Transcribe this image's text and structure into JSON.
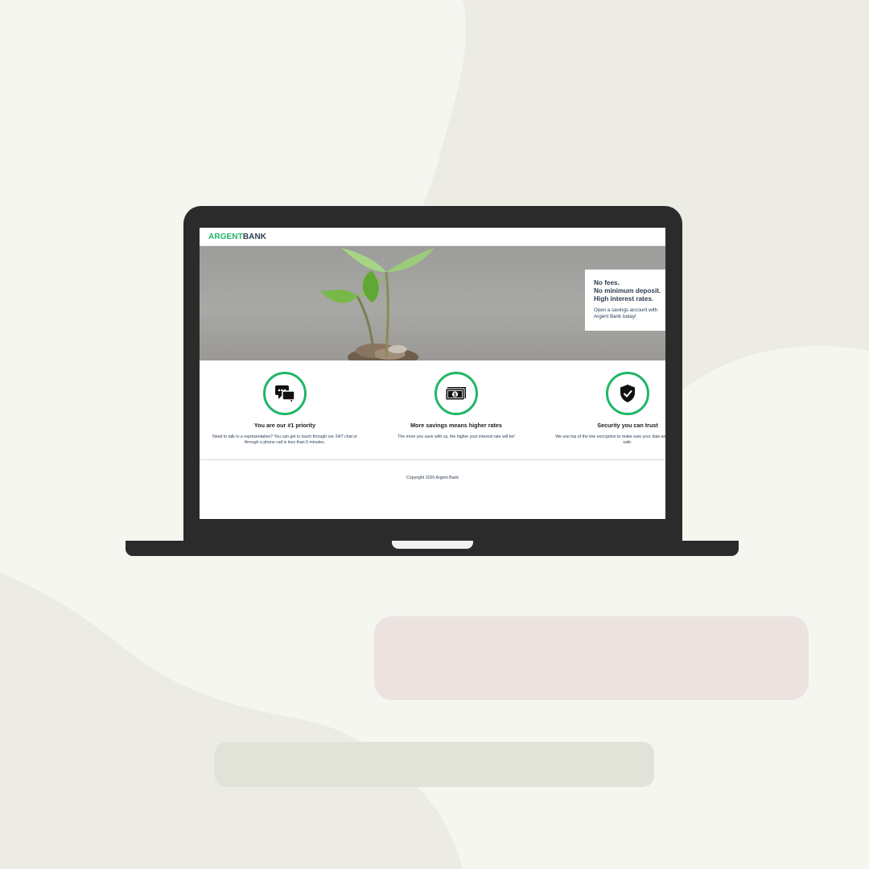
{
  "site": {
    "logo_part1": "ARGENT",
    "logo_part2": "BANK"
  },
  "hero": {
    "subtitle_lines": [
      "No fees.",
      "No minimum deposit.",
      "High interest rates."
    ],
    "text_lines": [
      "Open a savings account with",
      "Argent Bank today!"
    ]
  },
  "features": [
    {
      "icon": "chat-icon",
      "title": "You are our #1 priority",
      "text": "Need to talk to a representative? You can get in touch through our 24/7 chat or through a phone call in less than 5 minutes."
    },
    {
      "icon": "money-icon",
      "title": "More savings means higher rates",
      "text": "The more you save with us, the higher your interest rate will be!"
    },
    {
      "icon": "security-icon",
      "title": "Security you can trust",
      "text": "We use top of the line encryption to make sure your data and money is always safe."
    }
  ],
  "footer": {
    "copyright": "Copyright 2020 Argent Bank"
  },
  "colors": {
    "accent": "#1fb766",
    "text_dark": "#2c3e50",
    "laptop": "#2b2b2b",
    "background": "#f6f6f1"
  }
}
